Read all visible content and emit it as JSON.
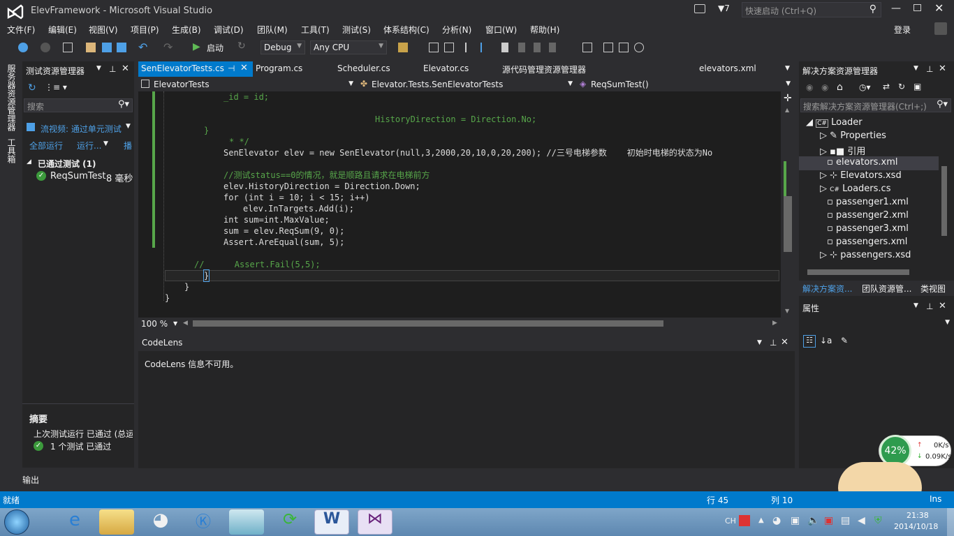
{
  "window": {
    "title": "ElevFramework - Microsoft Visual Studio",
    "notif_count": "7",
    "quick_launch": "快速启动 (Ctrl+Q)",
    "login": "登录"
  },
  "menu": [
    "文件(F)",
    "编辑(E)",
    "视图(V)",
    "项目(P)",
    "生成(B)",
    "调试(D)",
    "团队(M)",
    "工具(T)",
    "测试(S)",
    "体系结构(C)",
    "分析(N)",
    "窗口(W)",
    "帮助(H)"
  ],
  "toolbar": {
    "start": "启动",
    "config": "Debug",
    "platform": "Any CPU"
  },
  "vtabs": [
    "服务器资源管理器",
    "工具箱"
  ],
  "test_explorer": {
    "title": "测试资源管理器",
    "search_placeholder": "搜索",
    "playlist": "流视频: 通过单元测试",
    "run_all": "全部运行",
    "run": "运行...",
    "more": "播",
    "group": "已通过测试 (1)",
    "test_name": "ReqSumTest",
    "test_time": "8 毫秒",
    "summary_title": "摘要",
    "last_run": "上次测试运行 已通过 (总运",
    "result": "1 个测试 已通过"
  },
  "editor": {
    "tabs": [
      "SenElevatorTests.cs",
      "Program.cs",
      "Scheduler.cs",
      "Elevator.cs",
      "源代码管理资源管理器",
      "elevators.xml"
    ],
    "nav": [
      "ElevatorTests",
      "Elevator.Tests.SenElevatorTests",
      "ReqSumTest()"
    ],
    "zoom": "100 %",
    "lines": [
      "_id = id;",
      "HistoryDirection = Direction.No;",
      "}",
      "* */",
      "SenElevator elev = new SenElevator(null,3,2000,20,10,0,20,200); //三号电梯参数    初始时电梯的状态为No",
      "//测试status==0的情况，就是顺路且请求在电梯前方",
      "elev.HistoryDirection = Direction.Down;",
      "for (int i = 10; i < 15; i++)",
      "elev.InTargets.Add(i);",
      "int sum=int.MaxValue;",
      "sum = elev.ReqSum(9, 0);",
      "Assert.AreEqual(sum, 5);",
      "//      Assert.Fail(5,5);",
      "}",
      "}",
      "}"
    ]
  },
  "codelens": {
    "title": "CodeLens",
    "message": "CodeLens 信息不可用。"
  },
  "solution_explorer": {
    "title": "解决方案资源管理器",
    "search_placeholder": "搜索解决方案资源管理器(Ctrl+;)",
    "items": [
      "Loader",
      "Properties",
      "引用",
      "elevators.xml",
      "Elevators.xsd",
      "Loaders.cs",
      "passenger1.xml",
      "passenger2.xml",
      "passenger3.xml",
      "passengers.xml",
      "passengers.xsd"
    ],
    "tabs": [
      "解决方案资...",
      "团队资源管...",
      "类视图"
    ]
  },
  "properties": {
    "title": "属性"
  },
  "output": {
    "title": "输出"
  },
  "status": {
    "ready": "就绪",
    "line": "行 45",
    "col": "列 10",
    "ins": "Ins"
  },
  "netmon": {
    "percent": "42%",
    "up": "0K/s",
    "down": "0.09K/s"
  },
  "tray": {
    "lang": "CH",
    "time": "21:38",
    "date": "2014/10/18"
  },
  "colors": {
    "accent": "#007acc",
    "editor_bg": "#1e1e1e",
    "chrome": "#2d2d30",
    "panel": "#252526",
    "selection": "#007acc"
  }
}
